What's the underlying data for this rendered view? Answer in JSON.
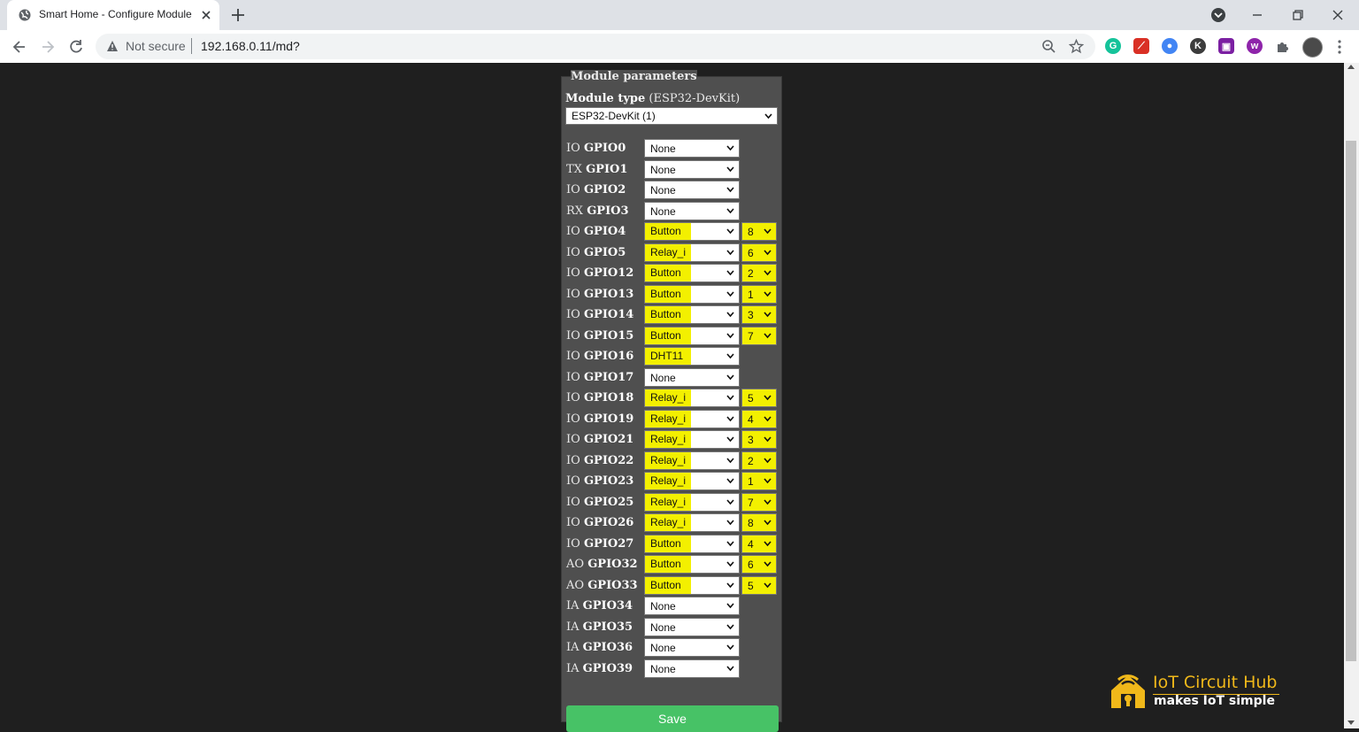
{
  "browser": {
    "tab_title": "Smart Home - Configure Module",
    "security_label": "Not secure",
    "url": "192.168.0.11/md?"
  },
  "form": {
    "legend": "Module parameters",
    "module_type_label": "Module type",
    "module_type_current": "(ESP32-DevKit)",
    "module_type_selected": "ESP32-DevKit (1)",
    "save_label": "Save",
    "highlight_color": "#f3f000",
    "gpio_rows": [
      {
        "mode": "IO",
        "pin": "GPIO0",
        "function": "None",
        "index": null
      },
      {
        "mode": "TX",
        "pin": "GPIO1",
        "function": "None",
        "index": null
      },
      {
        "mode": "IO",
        "pin": "GPIO2",
        "function": "None",
        "index": null
      },
      {
        "mode": "RX",
        "pin": "GPIO3",
        "function": "None",
        "index": null
      },
      {
        "mode": "IO",
        "pin": "GPIO4",
        "function": "Button",
        "index": "8"
      },
      {
        "mode": "IO",
        "pin": "GPIO5",
        "function": "Relay_i",
        "index": "6"
      },
      {
        "mode": "IO",
        "pin": "GPIO12",
        "function": "Button",
        "index": "2"
      },
      {
        "mode": "IO",
        "pin": "GPIO13",
        "function": "Button",
        "index": "1"
      },
      {
        "mode": "IO",
        "pin": "GPIO14",
        "function": "Button",
        "index": "3"
      },
      {
        "mode": "IO",
        "pin": "GPIO15",
        "function": "Button",
        "index": "7"
      },
      {
        "mode": "IO",
        "pin": "GPIO16",
        "function": "DHT11",
        "index": null
      },
      {
        "mode": "IO",
        "pin": "GPIO17",
        "function": "None",
        "index": null
      },
      {
        "mode": "IO",
        "pin": "GPIO18",
        "function": "Relay_i",
        "index": "5"
      },
      {
        "mode": "IO",
        "pin": "GPIO19",
        "function": "Relay_i",
        "index": "4"
      },
      {
        "mode": "IO",
        "pin": "GPIO21",
        "function": "Relay_i",
        "index": "3"
      },
      {
        "mode": "IO",
        "pin": "GPIO22",
        "function": "Relay_i",
        "index": "2"
      },
      {
        "mode": "IO",
        "pin": "GPIO23",
        "function": "Relay_i",
        "index": "1"
      },
      {
        "mode": "IO",
        "pin": "GPIO25",
        "function": "Relay_i",
        "index": "7"
      },
      {
        "mode": "IO",
        "pin": "GPIO26",
        "function": "Relay_i",
        "index": "8"
      },
      {
        "mode": "IO",
        "pin": "GPIO27",
        "function": "Button",
        "index": "4"
      },
      {
        "mode": "AO",
        "pin": "GPIO32",
        "function": "Button",
        "index": "6"
      },
      {
        "mode": "AO",
        "pin": "GPIO33",
        "function": "Button",
        "index": "5"
      },
      {
        "mode": "IA",
        "pin": "GPIO34",
        "function": "None",
        "index": null
      },
      {
        "mode": "IA",
        "pin": "GPIO35",
        "function": "None",
        "index": null
      },
      {
        "mode": "IA",
        "pin": "GPIO36",
        "function": "None",
        "index": null
      },
      {
        "mode": "IA",
        "pin": "GPIO39",
        "function": "None",
        "index": null
      }
    ]
  },
  "watermark": {
    "brand": "IoT Circuit Hub",
    "tagline": "makes IoT simple"
  }
}
